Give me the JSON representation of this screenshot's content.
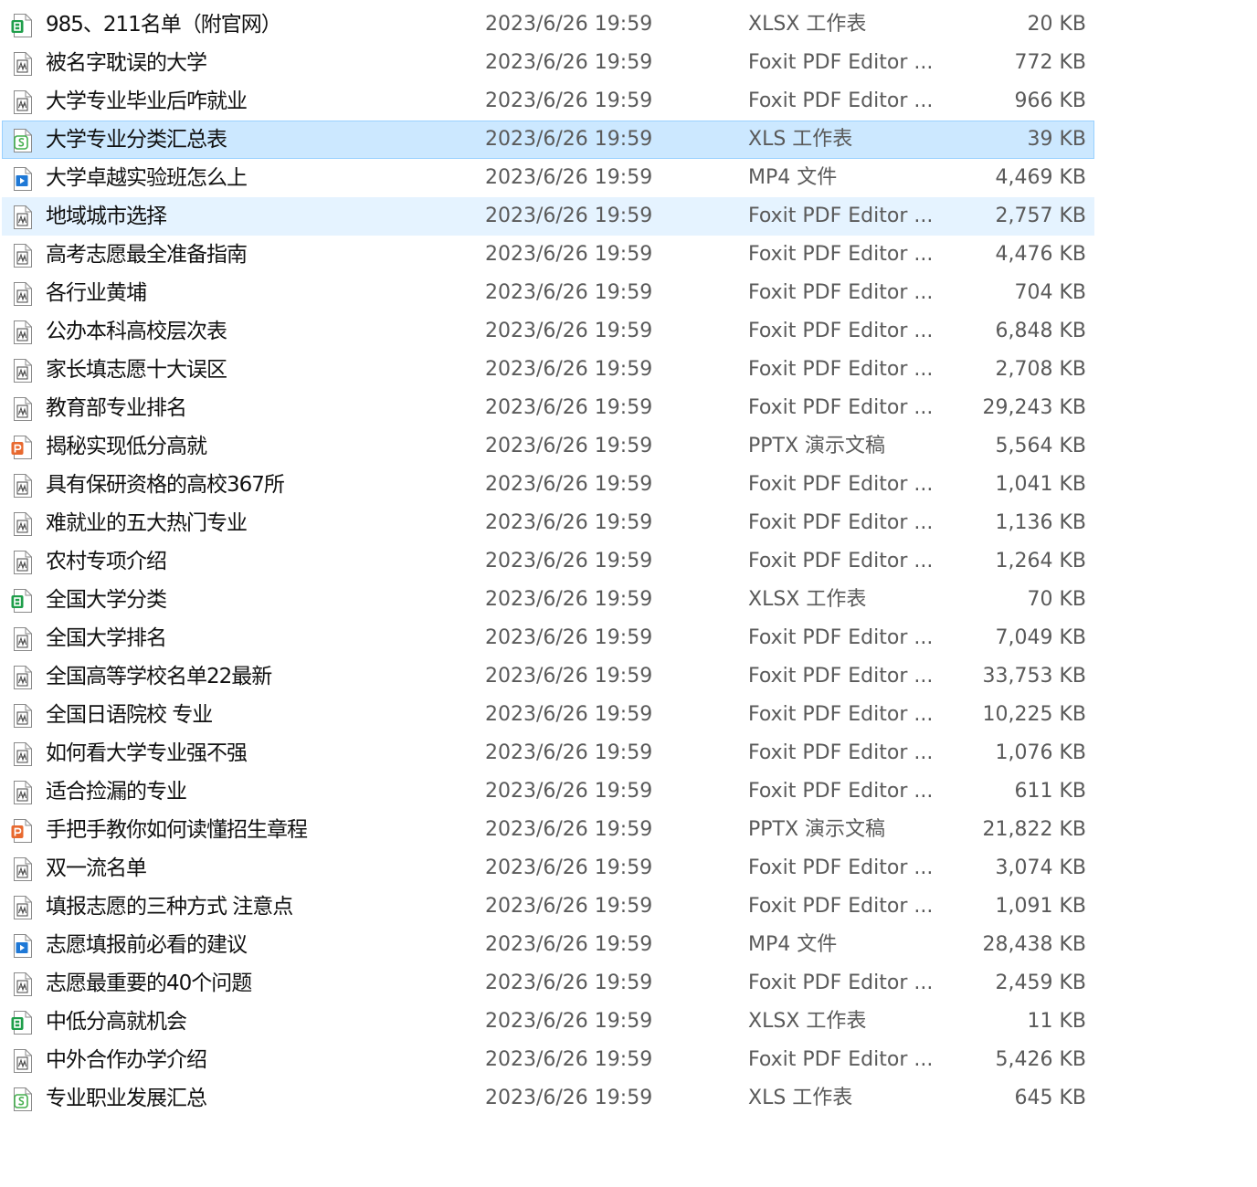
{
  "file_list": {
    "rows": [
      {
        "name": "985、211名单（附官网）",
        "date": "2023/6/26 19:59",
        "type": "XLSX 工作表",
        "size": "20 KB",
        "icon": "xlsx-file-icon",
        "state": ""
      },
      {
        "name": "被名字耽误的大学",
        "date": "2023/6/26 19:59",
        "type": "Foxit PDF Editor ...",
        "size": "772 KB",
        "icon": "pdf-file-icon",
        "state": ""
      },
      {
        "name": "大学专业毕业后咋就业",
        "date": "2023/6/26 19:59",
        "type": "Foxit PDF Editor ...",
        "size": "966 KB",
        "icon": "pdf-file-icon",
        "state": ""
      },
      {
        "name": "大学专业分类汇总表",
        "date": "2023/6/26 19:59",
        "type": "XLS 工作表",
        "size": "39 KB",
        "icon": "xls-file-icon",
        "state": "selected"
      },
      {
        "name": "大学卓越实验班怎么上",
        "date": "2023/6/26 19:59",
        "type": "MP4 文件",
        "size": "4,469 KB",
        "icon": "mp4-file-icon",
        "state": ""
      },
      {
        "name": "地域城市选择",
        "date": "2023/6/26 19:59",
        "type": "Foxit PDF Editor ...",
        "size": "2,757 KB",
        "icon": "pdf-file-icon",
        "state": "hovered"
      },
      {
        "name": "高考志愿最全准备指南",
        "date": "2023/6/26 19:59",
        "type": "Foxit PDF Editor ...",
        "size": "4,476 KB",
        "icon": "pdf-file-icon",
        "state": ""
      },
      {
        "name": "各行业黄埔",
        "date": "2023/6/26 19:59",
        "type": "Foxit PDF Editor ...",
        "size": "704 KB",
        "icon": "pdf-file-icon",
        "state": ""
      },
      {
        "name": "公办本科高校层次表",
        "date": "2023/6/26 19:59",
        "type": "Foxit PDF Editor ...",
        "size": "6,848 KB",
        "icon": "pdf-file-icon",
        "state": ""
      },
      {
        "name": "家长填志愿十大误区",
        "date": "2023/6/26 19:59",
        "type": "Foxit PDF Editor ...",
        "size": "2,708 KB",
        "icon": "pdf-file-icon",
        "state": ""
      },
      {
        "name": "教育部专业排名",
        "date": "2023/6/26 19:59",
        "type": "Foxit PDF Editor ...",
        "size": "29,243 KB",
        "icon": "pdf-file-icon",
        "state": ""
      },
      {
        "name": "揭秘实现低分高就",
        "date": "2023/6/26 19:59",
        "type": "PPTX 演示文稿",
        "size": "5,564 KB",
        "icon": "pptx-file-icon",
        "state": ""
      },
      {
        "name": "具有保研资格的高校367所",
        "date": "2023/6/26 19:59",
        "type": "Foxit PDF Editor ...",
        "size": "1,041 KB",
        "icon": "pdf-file-icon",
        "state": ""
      },
      {
        "name": "难就业的五大热门专业",
        "date": "2023/6/26 19:59",
        "type": "Foxit PDF Editor ...",
        "size": "1,136 KB",
        "icon": "pdf-file-icon",
        "state": ""
      },
      {
        "name": "农村专项介绍",
        "date": "2023/6/26 19:59",
        "type": "Foxit PDF Editor ...",
        "size": "1,264 KB",
        "icon": "pdf-file-icon",
        "state": ""
      },
      {
        "name": "全国大学分类",
        "date": "2023/6/26 19:59",
        "type": "XLSX 工作表",
        "size": "70 KB",
        "icon": "xlsx-file-icon",
        "state": ""
      },
      {
        "name": "全国大学排名",
        "date": "2023/6/26 19:59",
        "type": "Foxit PDF Editor ...",
        "size": "7,049 KB",
        "icon": "pdf-file-icon",
        "state": ""
      },
      {
        "name": "全国高等学校名单22最新",
        "date": "2023/6/26 19:59",
        "type": "Foxit PDF Editor ...",
        "size": "33,753 KB",
        "icon": "pdf-file-icon",
        "state": ""
      },
      {
        "name": "全国日语院校 专业",
        "date": "2023/6/26 19:59",
        "type": "Foxit PDF Editor ...",
        "size": "10,225 KB",
        "icon": "pdf-file-icon",
        "state": ""
      },
      {
        "name": "如何看大学专业强不强",
        "date": "2023/6/26 19:59",
        "type": "Foxit PDF Editor ...",
        "size": "1,076 KB",
        "icon": "pdf-file-icon",
        "state": ""
      },
      {
        "name": "适合捡漏的专业",
        "date": "2023/6/26 19:59",
        "type": "Foxit PDF Editor ...",
        "size": "611 KB",
        "icon": "pdf-file-icon",
        "state": ""
      },
      {
        "name": "手把手教你如何读懂招生章程",
        "date": "2023/6/26 19:59",
        "type": "PPTX 演示文稿",
        "size": "21,822 KB",
        "icon": "pptx-file-icon",
        "state": ""
      },
      {
        "name": "双一流名单",
        "date": "2023/6/26 19:59",
        "type": "Foxit PDF Editor ...",
        "size": "3,074 KB",
        "icon": "pdf-file-icon",
        "state": ""
      },
      {
        "name": "填报志愿的三种方式 注意点",
        "date": "2023/6/26 19:59",
        "type": "Foxit PDF Editor ...",
        "size": "1,091 KB",
        "icon": "pdf-file-icon",
        "state": ""
      },
      {
        "name": "志愿填报前必看的建议",
        "date": "2023/6/26 19:59",
        "type": "MP4 文件",
        "size": "28,438 KB",
        "icon": "mp4-file-icon",
        "state": ""
      },
      {
        "name": "志愿最重要的40个问题",
        "date": "2023/6/26 19:59",
        "type": "Foxit PDF Editor ...",
        "size": "2,459 KB",
        "icon": "pdf-file-icon",
        "state": ""
      },
      {
        "name": "中低分高就机会",
        "date": "2023/6/26 19:59",
        "type": "XLSX 工作表",
        "size": "11 KB",
        "icon": "xlsx-file-icon",
        "state": ""
      },
      {
        "name": "中外合作办学介绍",
        "date": "2023/6/26 19:59",
        "type": "Foxit PDF Editor ...",
        "size": "5,426 KB",
        "icon": "pdf-file-icon",
        "state": ""
      },
      {
        "name": "专业职业发展汇总",
        "date": "2023/6/26 19:59",
        "type": "XLS 工作表",
        "size": "645 KB",
        "icon": "xls-file-icon",
        "state": ""
      }
    ]
  },
  "colors": {
    "selected_row_bg": "#cce8ff",
    "selected_row_border": "#99d1ff",
    "hover_row_bg": "#e5f3ff",
    "secondary_text": "#5a5a5a",
    "xlsx_green": "#1e9e4a",
    "xls_green": "#45b04f",
    "pptx_orange": "#e8692f",
    "mp4_blue": "#1e78d6"
  }
}
